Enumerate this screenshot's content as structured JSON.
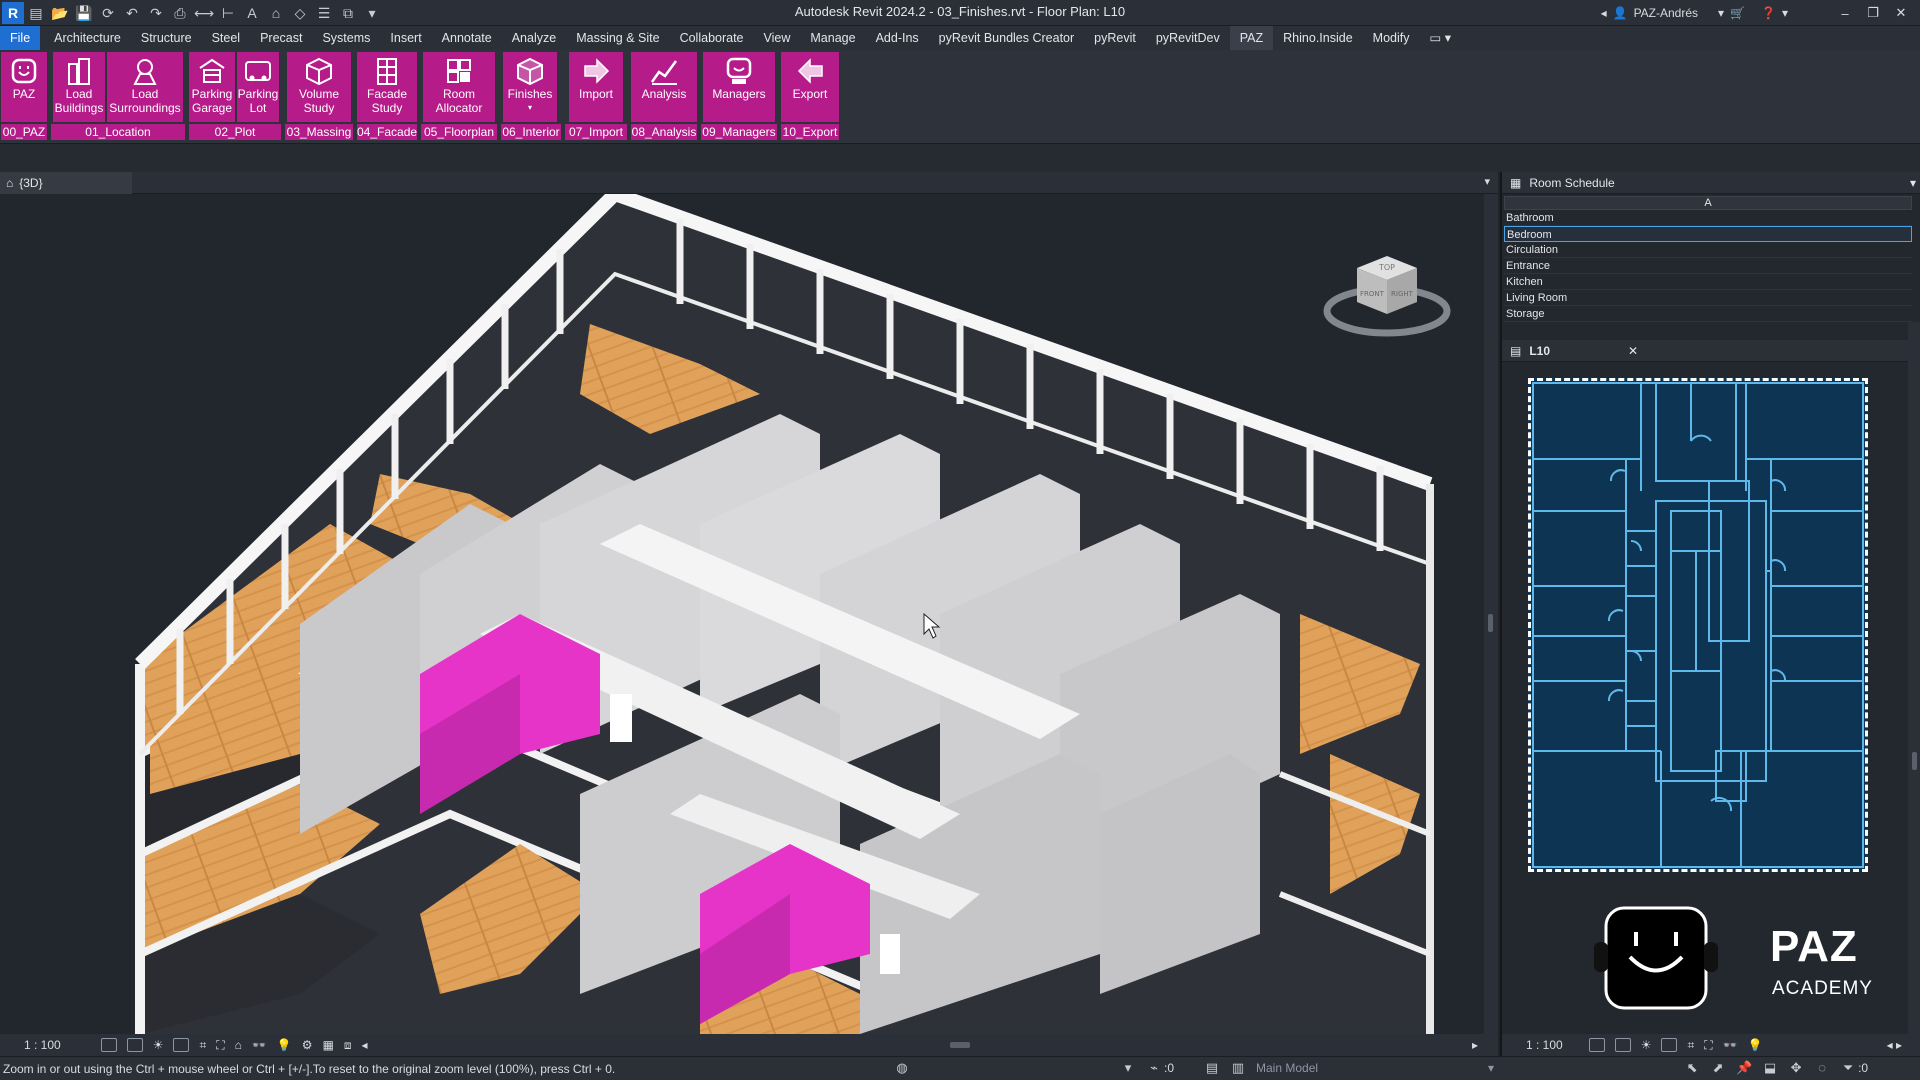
{
  "window": {
    "title": "Autodesk Revit 2024.2 - 03_Finishes.rvt - Floor Plan: L10",
    "user": "PAZ-Andrés"
  },
  "menu": {
    "tabs": [
      "File",
      "Architecture",
      "Structure",
      "Steel",
      "Precast",
      "Systems",
      "Insert",
      "Annotate",
      "Analyze",
      "Massing & Site",
      "Collaborate",
      "View",
      "Manage",
      "Add-Ins",
      "pyRevit Bundles Creator",
      "pyRevit",
      "pyRevitDev",
      "PAZ",
      "Rhino.Inside",
      "Modify"
    ],
    "active": "PAZ"
  },
  "ribbon": {
    "buttons": [
      {
        "label1": "PAZ",
        "label2": "",
        "icon": "paz-face-icon"
      },
      {
        "label1": "Load",
        "label2": "Buildings",
        "icon": "buildings-icon"
      },
      {
        "label1": "Load",
        "label2": "Surroundings",
        "icon": "surroundings-icon"
      },
      {
        "label1": "Parking",
        "label2": "Garage",
        "icon": "garage-icon"
      },
      {
        "label1": "Parking",
        "label2": "Lot",
        "icon": "parking-lot-icon"
      },
      {
        "label1": "Volume",
        "label2": "Study",
        "icon": "volume-icon"
      },
      {
        "label1": "Facade",
        "label2": "Study",
        "icon": "facade-icon"
      },
      {
        "label1": "Room",
        "label2": "Allocator",
        "icon": "room-allocator-icon"
      },
      {
        "label1": "Finishes",
        "label2": "▾",
        "icon": "finishes-icon"
      },
      {
        "label1": "Import",
        "label2": "",
        "icon": "import-arrow-icon"
      },
      {
        "label1": "Analysis",
        "label2": "",
        "icon": "analysis-chart-icon"
      },
      {
        "label1": "Managers",
        "label2": "",
        "icon": "managers-icon"
      },
      {
        "label1": "Export",
        "label2": "",
        "icon": "export-arrow-icon"
      }
    ],
    "panels": [
      "00_PAZ",
      "01_Location",
      "02_Plot",
      "03_Massing",
      "04_Facade",
      "05_Floorplan",
      "06_Interior",
      "07_Import",
      "08_Analysis",
      "09_Managers",
      "10_Export"
    ]
  },
  "view3d": {
    "tab_label": "{3D}",
    "scale": "1 : 100",
    "viewcube": {
      "top": "TOP",
      "front": "FRONT",
      "right": "RIGHT"
    }
  },
  "schedule": {
    "title": "Room Schedule",
    "column": "A",
    "rows": [
      "Bathroom",
      "Bedroom",
      "Circulation",
      "Entrance",
      "Kitchen",
      "Living Room",
      "Storage"
    ],
    "selected": "Bedroom"
  },
  "plan": {
    "tab_label": "L10",
    "scale": "1 : 100"
  },
  "brand": {
    "line1": "PAZ",
    "line2": "ACADEMY"
  },
  "status": {
    "message": "Zoom in or out using the Ctrl + mouse wheel or Ctrl + [+/-].To reset to the original zoom level (100%), press Ctrl + 0.",
    "counter": ":0",
    "model": "Main Model",
    "filter_count": ":0"
  },
  "colors": {
    "accent": "#b51c8a",
    "finish": "#e633c8",
    "floor": "#e0a25a",
    "plan_bg": "#0d3452",
    "plan_line": "#5fb8ea"
  }
}
